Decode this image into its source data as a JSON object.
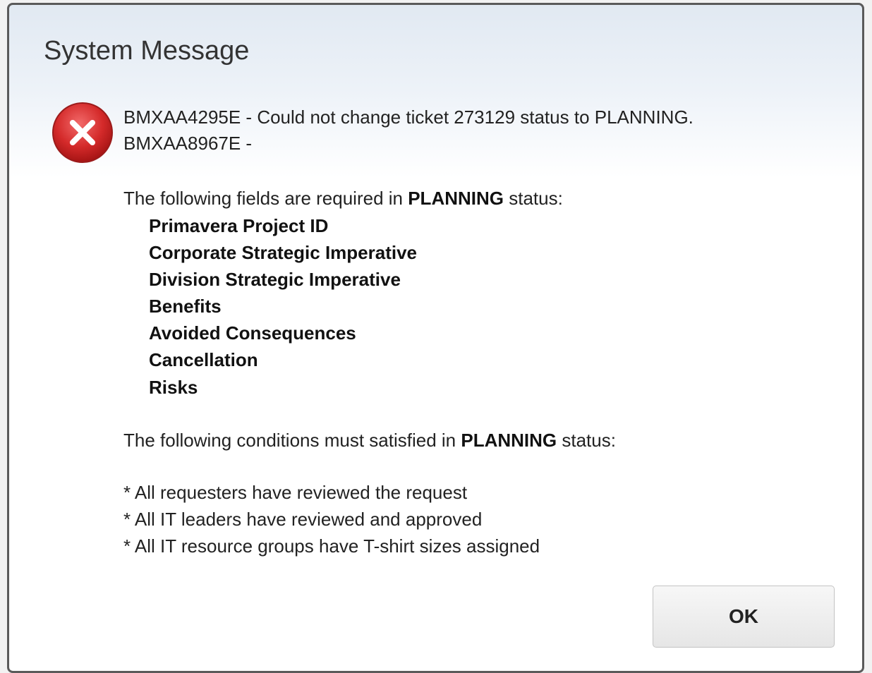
{
  "dialog": {
    "title": "System Message",
    "icon": "error-icon",
    "accent_color": "#d42a2a",
    "error_lines": [
      "BMXAA4295E - Could not change ticket 273129 status to PLANNING.",
      "BMXAA8967E -"
    ],
    "fields_intro": {
      "prefix": "The following fields are required in ",
      "status": "PLANNING",
      "suffix": " status:"
    },
    "required_fields": [
      "Primavera Project ID",
      "Corporate Strategic Imperative",
      "Division Strategic Imperative",
      "Benefits",
      "Avoided Consequences",
      "Cancellation",
      "Risks"
    ],
    "conditions_intro": {
      "prefix": "The following conditions must satisfied in ",
      "status": "PLANNING",
      "suffix": " status:"
    },
    "conditions": [
      "* All requesters have reviewed the request",
      "* All IT leaders have reviewed and approved",
      "* All IT resource groups have T-shirt sizes assigned"
    ],
    "ok_label": "OK"
  }
}
